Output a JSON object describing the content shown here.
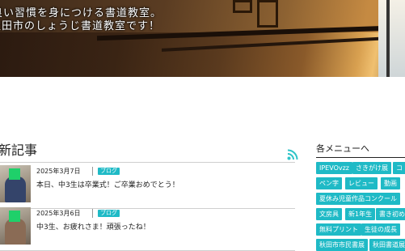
{
  "hero": {
    "line1": "良い習慣を身につける書道教室。",
    "line2": "秋田市のしょうじ書道教室です！"
  },
  "main": {
    "section_title": "新記事",
    "rss_icon": "rss-icon",
    "articles": [
      {
        "date": "2025年3月7日",
        "category": "ブログ",
        "title": "本日、中3生は卒業式！ご卒業おめでとう！"
      },
      {
        "date": "2025年3月6日",
        "category": "ブログ",
        "title": "中3生、お疲れさま！頑張ったね！"
      }
    ]
  },
  "sidebar": {
    "title": "各メニューへ",
    "tags": [
      "IPEVOvzz",
      "さきがけ展",
      "コ",
      "ペン字",
      "レビュー",
      "動画",
      "夏休み児童作品コンクール",
      "文房具",
      "新1年生",
      "書き初め",
      "無料プリント",
      "生徒の成長",
      "秋田市市民書展",
      "秋田書道展"
    ]
  },
  "colors": {
    "accent": "#1fbac6",
    "rss": "#2ec4c8"
  }
}
